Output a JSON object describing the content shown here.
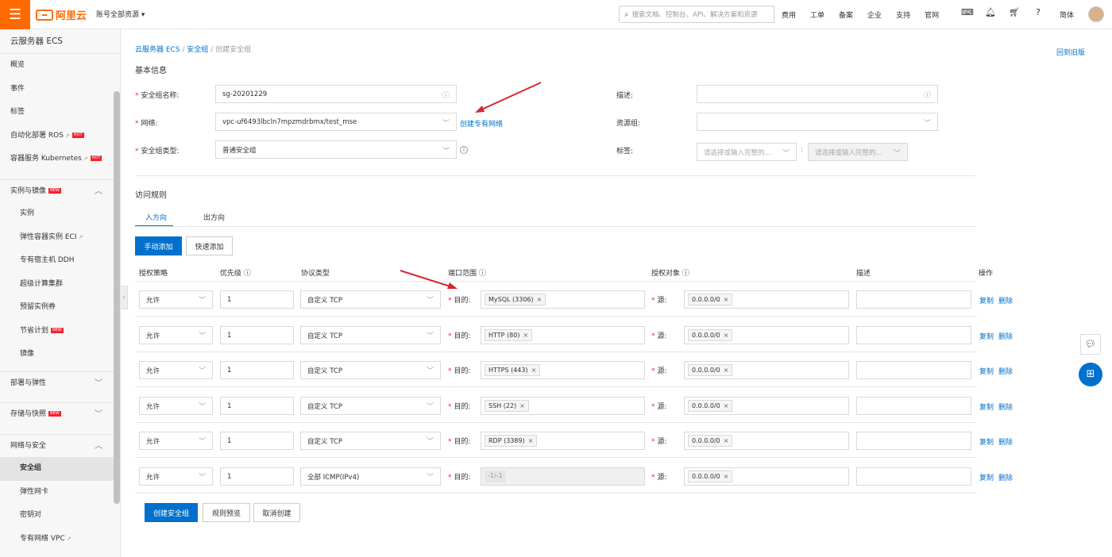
{
  "topbar": {
    "logo_text": "阿里云",
    "account_label": "账号全部资源",
    "search_placeholder": "搜索文档、控制台、API、解决方案和资源",
    "nav": [
      "费用",
      "工单",
      "备案",
      "企业",
      "支持",
      "官网"
    ],
    "icons": [
      "terminal-icon",
      "bell-icon",
      "cart-icon",
      "help-icon"
    ],
    "lang": "简体"
  },
  "sidebar": {
    "title": "云服务器 ECS",
    "items_top": [
      {
        "label": "概览"
      },
      {
        "label": "事件"
      },
      {
        "label": "标签"
      },
      {
        "label": "自动化部署 ROS",
        "ext": "↗",
        "hot": "HOT"
      },
      {
        "label": "容器服务 Kubernetes",
        "ext": "↗",
        "hot": "HOT"
      }
    ],
    "group_instances": {
      "label": "实例与镜像",
      "badge": "NEW"
    },
    "instances_items": [
      {
        "label": "实例"
      },
      {
        "label": "弹性容器实例 ECI",
        "ext": "↗"
      },
      {
        "label": "专有宿主机 DDH"
      },
      {
        "label": "超级计算集群"
      },
      {
        "label": "预留实例券"
      },
      {
        "label": "节省计划",
        "badge": "NEW"
      },
      {
        "label": "镜像"
      }
    ],
    "group_deploy": {
      "label": "部署与弹性"
    },
    "group_storage": {
      "label": "存储与快照",
      "badge": "NEW"
    },
    "group_network": {
      "label": "网络与安全"
    },
    "network_items": [
      {
        "label": "安全组"
      },
      {
        "label": "弹性网卡"
      },
      {
        "label": "密钥对"
      },
      {
        "label": "专有网络 VPC",
        "ext": "↗"
      }
    ]
  },
  "breadcrumb": {
    "ecs": "云服务器 ECS",
    "sep": "/",
    "sg": "安全组",
    "current": "创建安全组"
  },
  "back_link": "回到旧版",
  "basic": {
    "title": "基本信息",
    "name_label": "安全组名称:",
    "name_value": "sg-20201229",
    "network_label": "网络:",
    "network_value": "vpc-uf6493lbcln7mpzmdrbmx/test_mse",
    "create_vpc_link": "创建专有网络",
    "type_label": "安全组类型:",
    "type_value": "普通安全组",
    "desc_label": "描述:",
    "rg_label": "资源组:",
    "tag_label": "标签:",
    "tag_key_placeholder": "请选择或输入完整的...",
    "tag_value_placeholder": "请选择或输入完整的..."
  },
  "rules": {
    "title": "访问规则",
    "tab_in": "入方向",
    "tab_out": "出方向",
    "manual_add": "手动添加",
    "quick_add": "快速添加",
    "headers": {
      "policy": "授权策略",
      "priority": "优先级",
      "protocol": "协议类型",
      "port": "端口范围",
      "object": "授权对象",
      "desc": "描述",
      "ops": "操作"
    },
    "dest_label": "目的:",
    "src_label": "源:",
    "copy": "复制",
    "delete": "删除",
    "rows": [
      {
        "policy": "允许",
        "priority": "1",
        "protocol": "自定义 TCP",
        "port": "MySQL (3306)",
        "port_disabled": false,
        "source": "0.0.0.0/0"
      },
      {
        "policy": "允许",
        "priority": "1",
        "protocol": "自定义 TCP",
        "port": "HTTP (80)",
        "port_disabled": false,
        "source": "0.0.0.0/0"
      },
      {
        "policy": "允许",
        "priority": "1",
        "protocol": "自定义 TCP",
        "port": "HTTPS (443)",
        "port_disabled": false,
        "source": "0.0.0.0/0"
      },
      {
        "policy": "允许",
        "priority": "1",
        "protocol": "自定义 TCP",
        "port": "SSH (22)",
        "port_disabled": false,
        "source": "0.0.0.0/0"
      },
      {
        "policy": "允许",
        "priority": "1",
        "protocol": "自定义 TCP",
        "port": "RDP (3389)",
        "port_disabled": false,
        "source": "0.0.0.0/0"
      },
      {
        "policy": "允许",
        "priority": "1",
        "protocol": "全部 ICMP(IPv4)",
        "port": "-1/-1",
        "port_disabled": true,
        "source": "0.0.0.0/0"
      }
    ]
  },
  "footer": {
    "create": "创建安全组",
    "preview": "规则预览",
    "cancel": "取消创建"
  },
  "colors": {
    "brand": "#ff6a00",
    "primary": "#0070cc",
    "required": "#f5222d",
    "annotation_arrow": "#d9262b"
  }
}
